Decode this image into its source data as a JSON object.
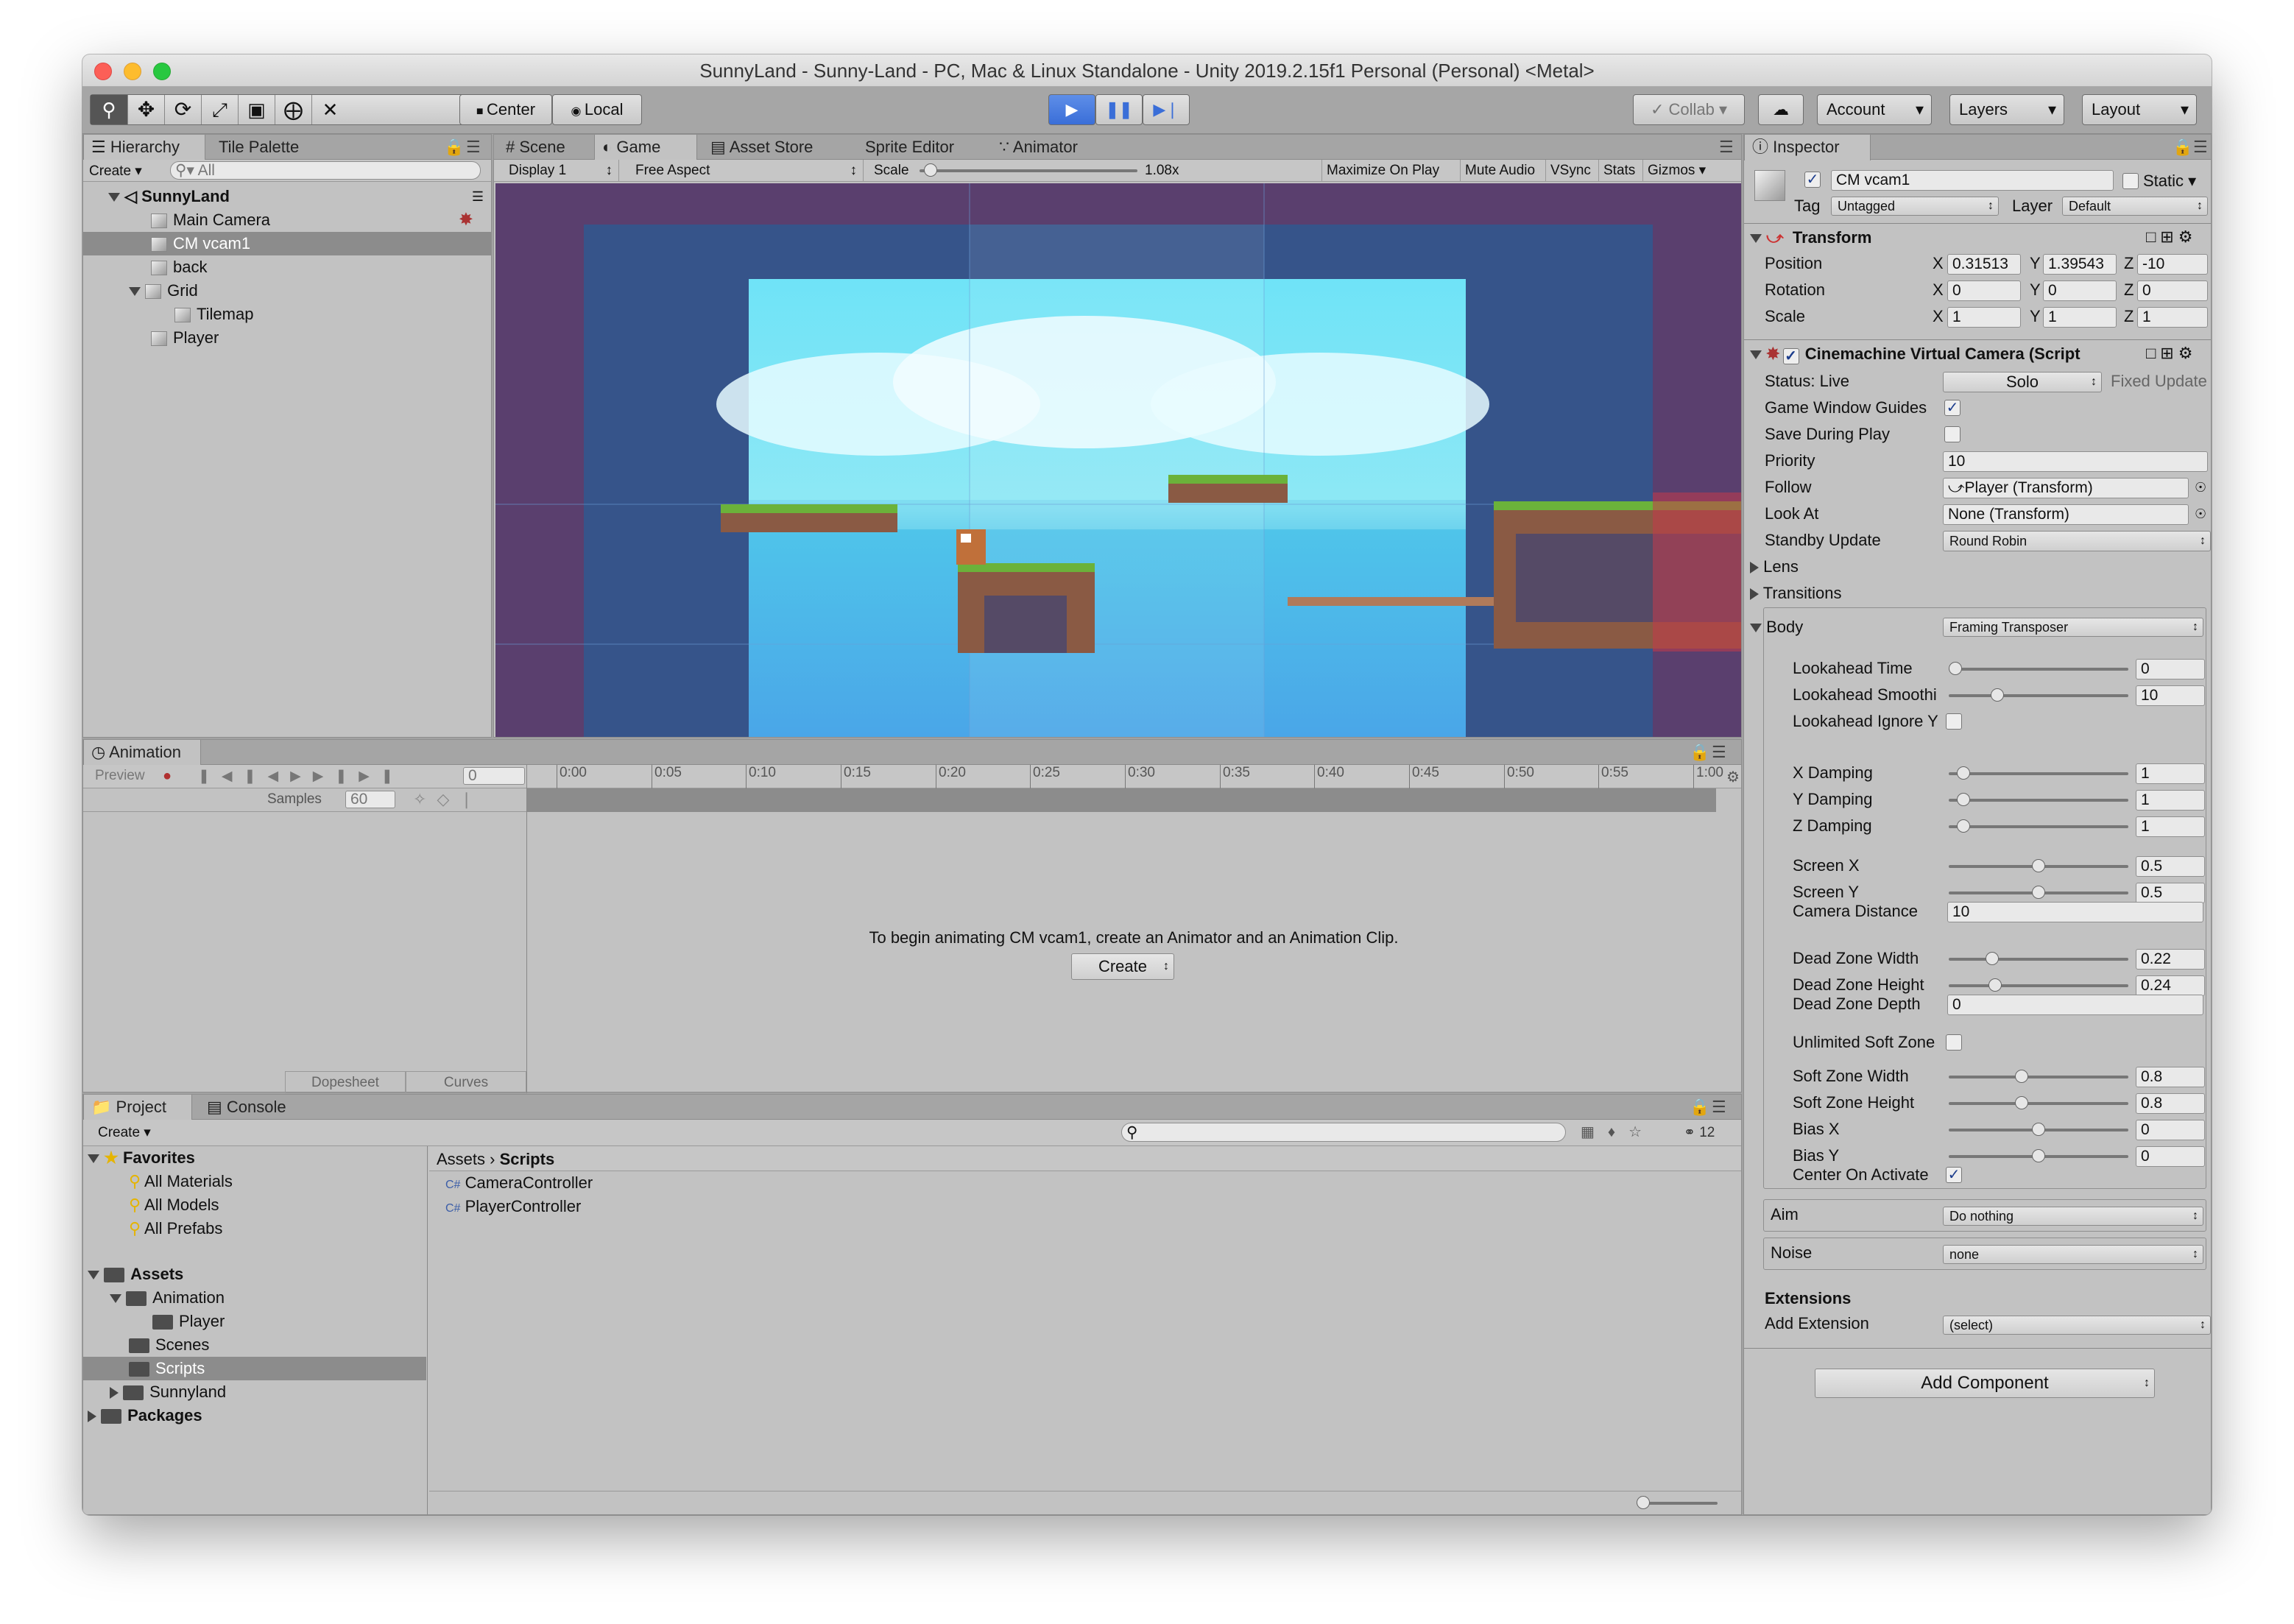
{
  "window": {
    "title": "SunnyLand - Sunny-Land - PC, Mac & Linux Standalone - Unity 2019.2.15f1 Personal (Personal) <Metal>"
  },
  "toolbar": {
    "tools": [
      "hand-tool",
      "move-tool",
      "rotate-tool",
      "scale-tool",
      "rect-tool",
      "transform-tool",
      "custom-tool"
    ],
    "pivot_label": "Center",
    "space_label": "Local",
    "collab_label": "Collab",
    "account_label": "Account",
    "layers_label": "Layers",
    "layout_label": "Layout"
  },
  "hierarchy": {
    "tabs": [
      "Hierarchy",
      "Tile Palette"
    ],
    "create_label": "Create",
    "search_placeholder": "All",
    "scene_name": "SunnyLand",
    "items": [
      "Main Camera",
      "CM vcam1",
      "back",
      "Grid",
      "Tilemap",
      "Player"
    ]
  },
  "scene_view": {
    "tabs": [
      "Scene",
      "Game",
      "Asset Store",
      "Sprite Editor",
      "Animator"
    ],
    "display": "Display 1",
    "aspect": "Free Aspect",
    "scale_label": "Scale",
    "scale_value": "1.08x",
    "scale_level": 0.02,
    "options": [
      "Maximize On Play",
      "Mute Audio",
      "VSync",
      "Stats",
      "Gizmos"
    ]
  },
  "animation": {
    "tab": "Animation",
    "preview_label": "Preview",
    "frame_value": "0",
    "samples_label": "Samples",
    "samples_value": "60",
    "timeline_ticks": [
      "0:00",
      "0:05",
      "0:10",
      "0:15",
      "0:20",
      "0:25",
      "0:30",
      "0:35",
      "0:40",
      "0:45",
      "0:50",
      "0:55",
      "1:00"
    ],
    "message": "To begin animating CM vcam1, create an Animator and an Animation Clip.",
    "create_button": "Create",
    "bottom_tabs": [
      "Dopesheet",
      "Curves"
    ]
  },
  "project": {
    "tabs": [
      "Project",
      "Console"
    ],
    "create_label": "Create",
    "hidden_count": "12",
    "favorites_label": "Favorites",
    "favorites": [
      "All Materials",
      "All Models",
      "All Prefabs"
    ],
    "assets_label": "Assets",
    "folders": [
      "Animation",
      "Player",
      "Scenes",
      "Scripts",
      "Sunnyland"
    ],
    "packages_label": "Packages",
    "breadcrumb": [
      "Assets",
      "Scripts"
    ],
    "files": [
      "CameraController",
      "PlayerController"
    ]
  },
  "inspector": {
    "tab": "Inspector",
    "object_name": "CM vcam1",
    "static_label": "Static",
    "tag_label": "Tag",
    "tag_value": "Untagged",
    "layer_label": "Layer",
    "layer_value": "Default",
    "transform": {
      "title": "Transform",
      "rows": [
        {
          "label": "Position",
          "x": "0.31513",
          "y": "1.39543",
          "z": "-10"
        },
        {
          "label": "Rotation",
          "x": "0",
          "y": "0",
          "z": "0"
        },
        {
          "label": "Scale",
          "x": "1",
          "y": "1",
          "z": "1"
        }
      ]
    },
    "vcam": {
      "title": "Cinemachine Virtual Camera (Script",
      "status": "Status: Live",
      "solo_button": "Solo",
      "fixed_update": "Fixed Update",
      "game_window_guides": "Game Window Guides",
      "save_during_play": "Save During Play",
      "priority_label": "Priority",
      "priority_value": "10",
      "follow_label": "Follow",
      "follow_value": "Player (Transform)",
      "lookat_label": "Look At",
      "lookat_value": "None (Transform)",
      "standby_label": "Standby Update",
      "standby_value": "Round Robin",
      "lens_label": "Lens",
      "transitions_label": "Transitions",
      "body_label": "Body",
      "body_value": "Framing Transposer",
      "body_sliders": [
        {
          "label": "Lookahead Time",
          "value": "0",
          "level": 0.0
        },
        {
          "label": "Lookahead Smoothi",
          "value": "10",
          "level": 0.25
        },
        {
          "label": "X Damping",
          "value": "1",
          "level": 0.05
        },
        {
          "label": "Y Damping",
          "value": "1",
          "level": 0.05
        },
        {
          "label": "Z Damping",
          "value": "1",
          "level": 0.05
        },
        {
          "label": "Screen X",
          "value": "0.5",
          "level": 0.5
        },
        {
          "label": "Screen Y",
          "value": "0.5",
          "level": 0.5
        },
        {
          "label": "Dead Zone Width",
          "value": "0.22",
          "level": 0.22
        },
        {
          "label": "Dead Zone Height",
          "value": "0.24",
          "level": 0.24
        },
        {
          "label": "Soft Zone Width",
          "value": "0.8",
          "level": 0.4
        },
        {
          "label": "Soft Zone Height",
          "value": "0.8",
          "level": 0.4
        },
        {
          "label": "Bias X",
          "value": "0",
          "level": 0.5
        },
        {
          "label": "Bias Y",
          "value": "0",
          "level": 0.5
        }
      ],
      "lookahead_ignore_y": "Lookahead Ignore Y",
      "camera_distance_label": "Camera Distance",
      "camera_distance_value": "10",
      "dead_zone_depth_label": "Dead Zone Depth",
      "dead_zone_depth_value": "0",
      "unlimited_soft_zone": "Unlimited Soft Zone",
      "center_on_activate": "Center On Activate",
      "aim_label": "Aim",
      "aim_value": "Do nothing",
      "noise_label": "Noise",
      "noise_value": "none",
      "extensions_label": "Extensions",
      "add_extension_label": "Add Extension",
      "add_extension_value": "(select)"
    },
    "add_component": "Add Component"
  },
  "colors": {
    "play_blue": "#3a6ed8",
    "panel_bg": "#c2c2c2",
    "selection": "#8c8c8c"
  }
}
